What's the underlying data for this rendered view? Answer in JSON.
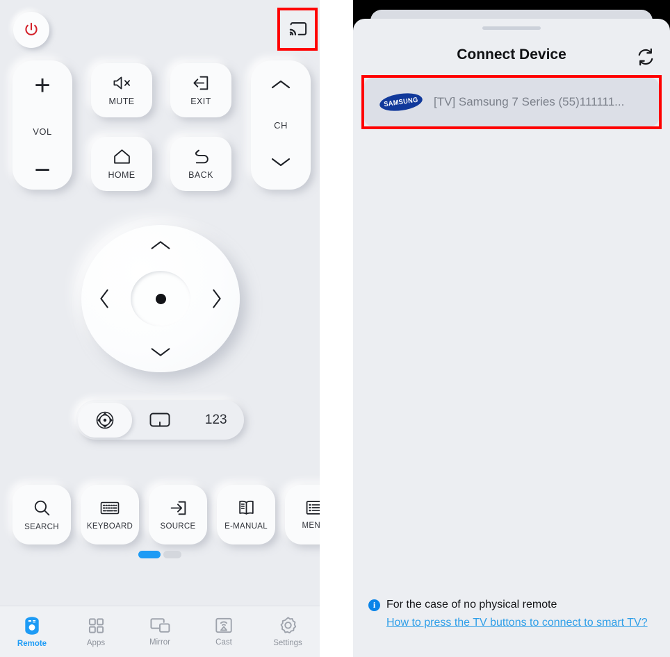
{
  "remote": {
    "power_button": "power-icon",
    "cast_button": "cast-icon",
    "vol": {
      "plus": "+",
      "label": "VOL",
      "minus": "−"
    },
    "ch": {
      "label": "CH"
    },
    "buttons": [
      {
        "label": "MUTE",
        "icon": "mute-icon"
      },
      {
        "label": "EXIT",
        "icon": "exit-icon"
      },
      {
        "label": "HOME",
        "icon": "home-icon"
      },
      {
        "label": "BACK",
        "icon": "back-icon"
      }
    ],
    "dpad": {
      "up": "chevron-up",
      "down": "chevron-down",
      "left": "chevron-left",
      "right": "chevron-right",
      "center": "ok-button"
    },
    "segmented": {
      "items": [
        {
          "label": "",
          "icon": "dpad-mode-icon",
          "selected": true
        },
        {
          "label": "",
          "icon": "touchpad-mode-icon",
          "selected": false
        },
        {
          "label": "123",
          "icon": "numpad-mode-icon",
          "selected": false
        }
      ]
    },
    "actions": [
      {
        "label": "SEARCH",
        "icon": "search-icon"
      },
      {
        "label": "KEYBOARD",
        "icon": "keyboard-icon"
      },
      {
        "label": "SOURCE",
        "icon": "source-icon"
      },
      {
        "label": "E-MANUAL",
        "icon": "emanual-icon"
      },
      {
        "label": "MENU",
        "icon": "menu-icon"
      }
    ],
    "pager": {
      "pages": 2,
      "active": 0
    },
    "tabs": [
      {
        "label": "Remote",
        "icon": "remote-icon",
        "active": true
      },
      {
        "label": "Apps",
        "icon": "apps-icon",
        "active": false
      },
      {
        "label": "Mirror",
        "icon": "mirror-icon",
        "active": false
      },
      {
        "label": "Cast",
        "icon": "cast-tab-icon",
        "active": false
      },
      {
        "label": "Settings",
        "icon": "gear-icon",
        "active": false
      }
    ]
  },
  "connect_sheet": {
    "title": "Connect Device",
    "refresh_label": "refresh-icon",
    "devices": [
      {
        "brand": "SAMSUNG",
        "name": "[TV] Samsung 7 Series (55)111111..."
      }
    ],
    "footer": {
      "note": "For the case of no physical remote",
      "link": "How to press the TV buttons to connect to smart TV?"
    }
  },
  "colors": {
    "accent_blue": "#1d9bf5",
    "link_blue": "#2f9fe8",
    "power_red": "#d32029",
    "highlight_red": "#ff0000",
    "samsung_blue": "#11399b",
    "panel_bg": "#eaecf0"
  }
}
